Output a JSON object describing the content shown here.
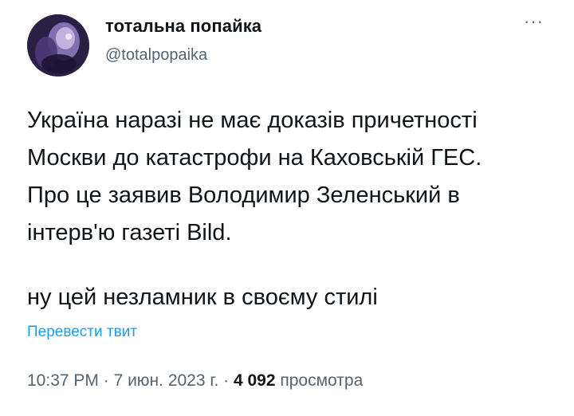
{
  "author": {
    "display_name": "тотальна попайка",
    "handle": "@totalpopaika"
  },
  "more_icon_glyph": "···",
  "tweet": {
    "text": "Україна наразі не має доказів причетності\nМоскви до катастрофи на Каховській ГЕС.\nПро це заявив Володимир Зеленський в\nінтерв'ю газеті Bild.",
    "comment": "ну цей незламник в своєму стилі",
    "translate_label": "Перевести твит"
  },
  "meta": {
    "time": "10:37 PM",
    "sep1": " · ",
    "date": "7 июн. 2023 г.",
    "sep2": " · ",
    "views_count": "4 092",
    "views_label": " просмотра"
  },
  "colors": {
    "text": "#0f1419",
    "secondary": "#536471",
    "link": "#1d9bf0"
  }
}
